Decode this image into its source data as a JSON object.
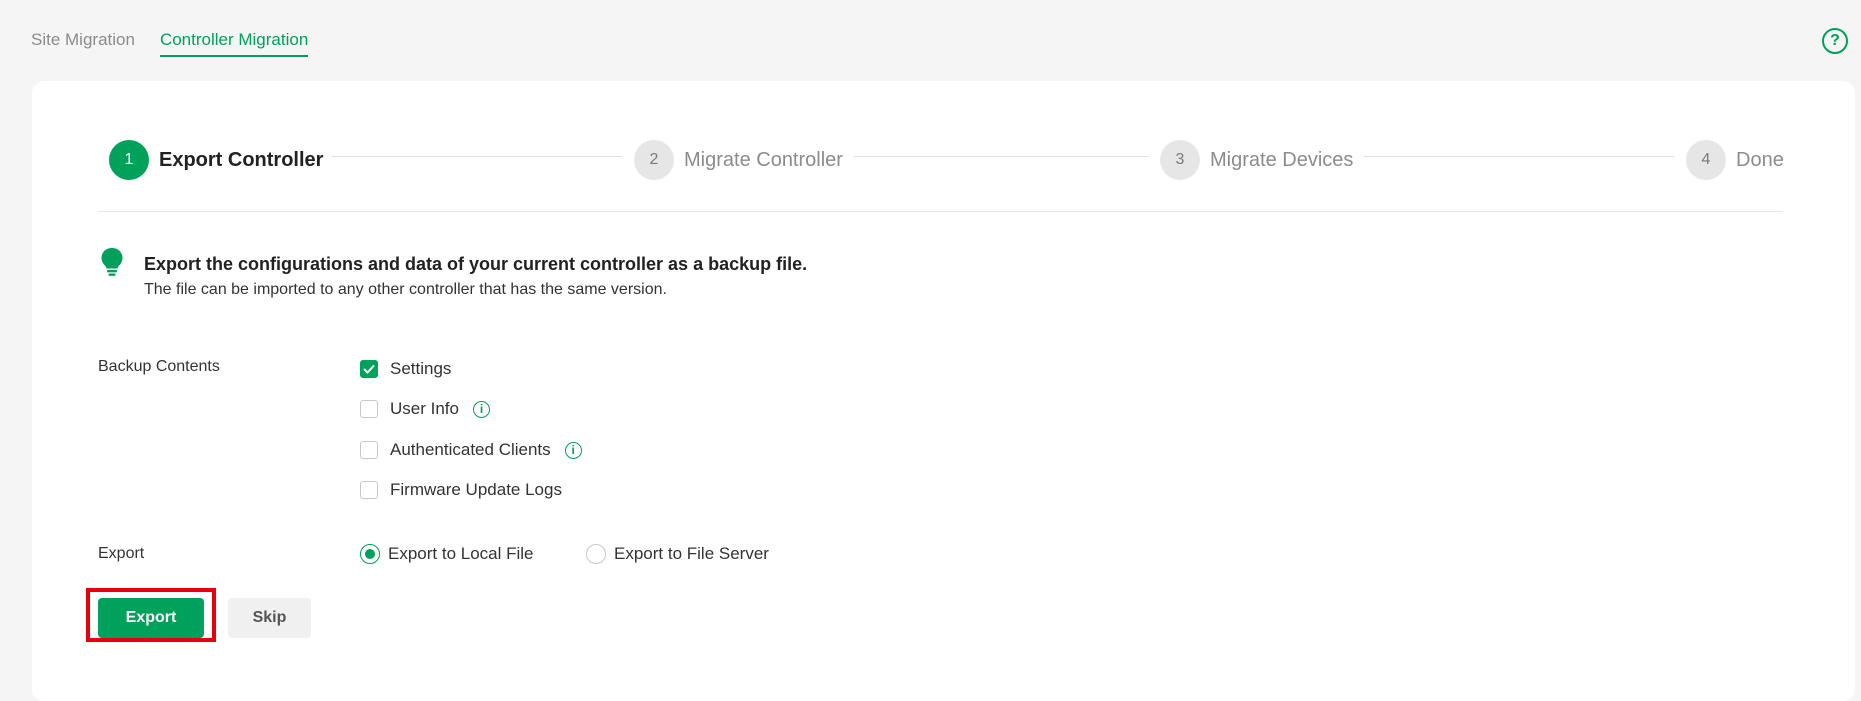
{
  "tabs": [
    {
      "label": "Site Migration",
      "active": false
    },
    {
      "label": "Controller Migration",
      "active": true
    }
  ],
  "help_icon": "question-circle-icon",
  "steps": [
    {
      "number": "1",
      "label": "Export Controller",
      "active": true
    },
    {
      "number": "2",
      "label": "Migrate Controller",
      "active": false
    },
    {
      "number": "3",
      "label": "Migrate Devices",
      "active": false
    },
    {
      "number": "4",
      "label": "Done",
      "active": false
    }
  ],
  "tip": {
    "icon": "lightbulb-icon",
    "title": "Export the configurations and data of your current controller as a backup file.",
    "subtitle": "The file can be imported to any other controller that has the same version."
  },
  "backup": {
    "label": "Backup Contents",
    "options": [
      {
        "label": "Settings",
        "checked": true,
        "info": false
      },
      {
        "label": "User Info",
        "checked": false,
        "info": true
      },
      {
        "label": "Authenticated Clients",
        "checked": false,
        "info": true
      },
      {
        "label": "Firmware Update Logs",
        "checked": false,
        "info": false
      }
    ]
  },
  "export": {
    "label": "Export",
    "options": [
      {
        "label": "Export to Local File",
        "selected": true
      },
      {
        "label": "Export to File Server",
        "selected": false
      }
    ]
  },
  "buttons": {
    "export": "Export",
    "skip": "Skip"
  },
  "colors": {
    "accent": "#00a15a",
    "highlight": "#e8000b"
  }
}
